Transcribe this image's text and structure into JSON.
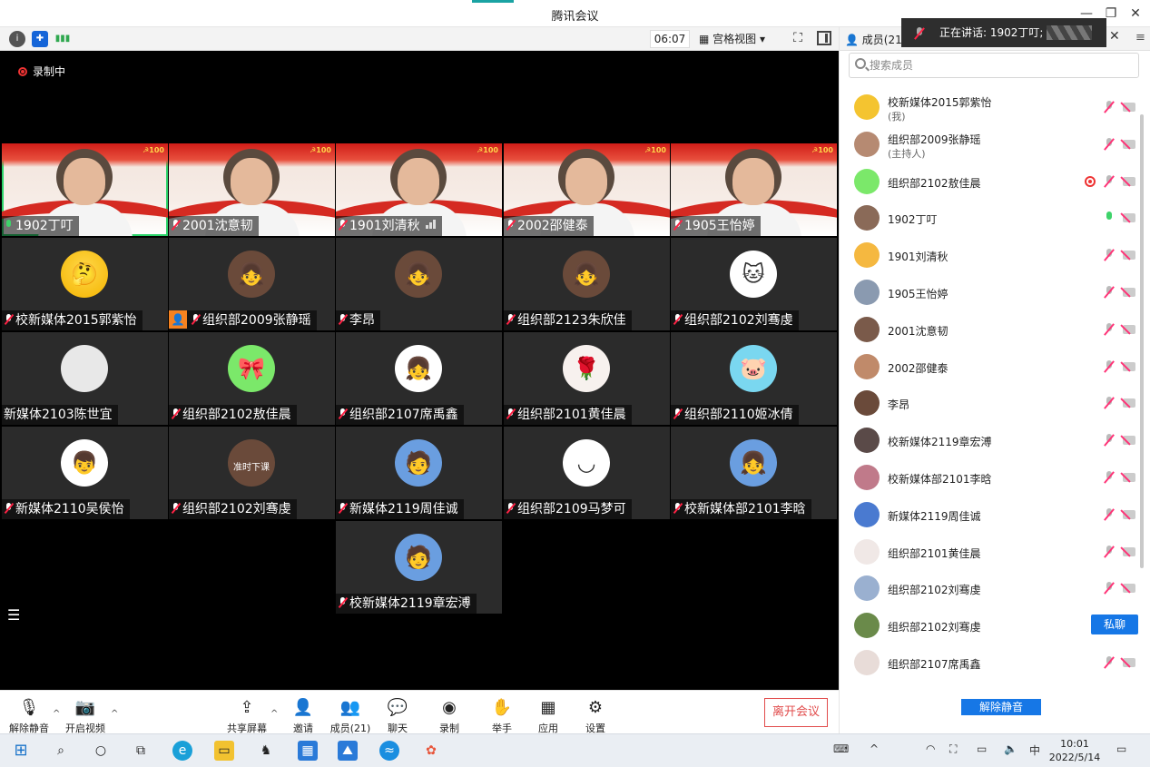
{
  "window": {
    "title": "腾讯会议",
    "minimize_icon": "minimize-icon",
    "restore_icon": "restore-icon",
    "close_icon": "close-icon"
  },
  "toolbar": {
    "timer": "06:07",
    "view_label": "宫格视图"
  },
  "recording": {
    "label": "录制中"
  },
  "speaking_banner": {
    "label": "正在讲话: 1902丁叮;"
  },
  "tiles_camera": [
    {
      "name": "1902丁叮",
      "mic": "on",
      "active": true
    },
    {
      "name": "2001沈意韧",
      "mic": "off"
    },
    {
      "name": "1901刘清秋",
      "mic": "off",
      "signal": true
    },
    {
      "name": "2002邵健泰",
      "mic": "off"
    },
    {
      "name": "1905王怡婷",
      "mic": "off"
    }
  ],
  "tiles_avatar": [
    {
      "name": "校新媒体2015郭紫怡",
      "mic": "off",
      "avatar": "thinking-emoji"
    },
    {
      "name": "组织部2009张静瑶",
      "mic": "off",
      "host": true,
      "avatar": "girl-photo"
    },
    {
      "name": "李昂",
      "mic": "off",
      "avatar": "girl-photo"
    },
    {
      "name": "组织部2123朱欣佳",
      "mic": "off",
      "avatar": "girl-photo"
    },
    {
      "name": "组织部2102刘骞虔",
      "mic": "off",
      "avatar": "cartoon-cat"
    },
    {
      "name": "新媒体2103陈世宜",
      "mic": "none",
      "avatar": "blank"
    },
    {
      "name": "组织部2102敖佳晨",
      "mic": "off",
      "avatar": "my-melody"
    },
    {
      "name": "组织部2107席禹鑫",
      "mic": "off",
      "avatar": "cartoon-girl"
    },
    {
      "name": "组织部2101黄佳晨",
      "mic": "off",
      "avatar": "red-flowers"
    },
    {
      "name": "组织部2110姬冰倩",
      "mic": "off",
      "avatar": "peppa-pig"
    },
    {
      "name": "新媒体2110吴侯怡",
      "mic": "off",
      "avatar": "crayon-shin"
    },
    {
      "name": "组织部2102刘骞虔",
      "mic": "off",
      "avatar": "green-character",
      "avatar_text": "准时下课"
    },
    {
      "name": "新媒体2119周佳诚",
      "mic": "off",
      "avatar": "anime-boy"
    },
    {
      "name": "组织部2109马梦可",
      "mic": "off",
      "avatar": "smiley-face"
    },
    {
      "name": "校新媒体部2101李晗",
      "mic": "off",
      "avatar": "anime-girl"
    },
    {
      "name": "校新媒体2119章宏溥",
      "mic": "off",
      "avatar": "anime-boy"
    }
  ],
  "controls": {
    "unmute": "解除静音",
    "start_video": "开启视频",
    "share_screen": "共享屏幕",
    "invite": "邀请",
    "members": "成员(21)",
    "chat": "聊天",
    "record": "录制",
    "raise_hand": "举手",
    "apps": "应用",
    "settings": "设置",
    "leave": "离开会议"
  },
  "panel": {
    "tab_label": "成员(21)",
    "search_placeholder": "搜索成员",
    "chat_button": "私聊",
    "unmute_all": "解除静音",
    "members": [
      {
        "name": "校新媒体2015郭紫怡",
        "sub": "(我)",
        "mic": "off"
      },
      {
        "name": "组织部2009张静瑶",
        "sub": "(主持人)",
        "mic": "off"
      },
      {
        "name": "组织部2102敖佳晨",
        "mic": "off",
        "rec": true
      },
      {
        "name": "1902丁叮",
        "mic": "on"
      },
      {
        "name": "1901刘清秋",
        "mic": "off"
      },
      {
        "name": "1905王怡婷",
        "mic": "off"
      },
      {
        "name": "2001沈意韧",
        "mic": "off"
      },
      {
        "name": "2002邵健泰",
        "mic": "off"
      },
      {
        "name": "李昂",
        "mic": "off"
      },
      {
        "name": "校新媒体2119章宏溥",
        "mic": "off"
      },
      {
        "name": "校新媒体部2101李晗",
        "mic": "off"
      },
      {
        "name": "新媒体2119周佳诚",
        "mic": "off"
      },
      {
        "name": "组织部2101黄佳晨",
        "mic": "off"
      },
      {
        "name": "组织部2102刘骞虔",
        "mic": "off"
      },
      {
        "name": "组织部2102刘骞虔",
        "chat": true
      },
      {
        "name": "组织部2107席禹鑫",
        "mic": "off"
      }
    ]
  },
  "taskbar": {
    "time": "10:01",
    "date": "2022/5/14",
    "ime": "中"
  },
  "colors": {
    "accent_blue": "#1677e6",
    "leave_red": "#e14c4c",
    "active_green": "#2bd46a"
  }
}
